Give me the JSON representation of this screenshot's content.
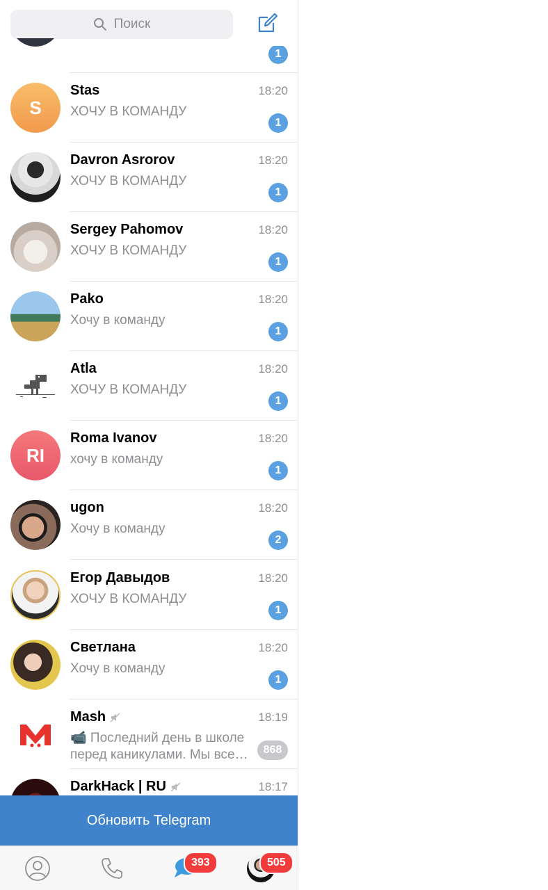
{
  "search": {
    "placeholder": "Поиск"
  },
  "colors": {
    "accent": "#3e83cb",
    "badge": "#5ba0e0",
    "muted_badge": "#c7c7cc",
    "tab_badge": "#f23c3c"
  },
  "chats": [
    {
      "name": "",
      "time": "",
      "message": "",
      "unread": "1",
      "avatar": "photo"
    },
    {
      "name": "Stas",
      "time": "18:20",
      "message": "ХОЧУ В КОМАНДУ",
      "unread": "1",
      "avatar": "initial",
      "initial": "S"
    },
    {
      "name": "Davron Asrorov",
      "time": "18:20",
      "message": "ХОЧУ В КОМАНДУ",
      "unread": "1",
      "avatar": "photo"
    },
    {
      "name": "Sergey Pahomov",
      "time": "18:20",
      "message": "ХОЧУ В КОМАНДУ",
      "unread": "1",
      "avatar": "photo"
    },
    {
      "name": "Pako",
      "time": "18:20",
      "message": "Хочу в команду",
      "unread": "1",
      "avatar": "photo"
    },
    {
      "name": "Atla",
      "time": "18:20",
      "message": "ХОЧУ В КОМАНДУ",
      "unread": "1",
      "avatar": "dino-icon"
    },
    {
      "name": "Roma Ivanov",
      "time": "18:20",
      "message": "хочу в команду",
      "unread": "1",
      "avatar": "initial",
      "initial": "RI"
    },
    {
      "name": "ugon",
      "time": "18:20",
      "message": "Хочу в команду",
      "unread": "2",
      "avatar": "photo"
    },
    {
      "name": "Егор Давыдов",
      "time": "18:20",
      "message": "ХОЧУ В КОМАНДУ",
      "unread": "1",
      "avatar": "photo"
    },
    {
      "name": "Светлана",
      "time": "18:20",
      "message": "Хочу в команду",
      "unread": "1",
      "avatar": "photo"
    },
    {
      "name": "Mash",
      "time": "18:19",
      "message": "📹 Последний день в школе перед каникулами. Мы все…",
      "unread": "868",
      "muted": true,
      "avatar": "mash-logo"
    },
    {
      "name": "DarkHack | RU",
      "time": "18:17",
      "message": "",
      "unread": "",
      "muted": true,
      "avatar": "photo"
    }
  ],
  "update_bar": {
    "label": "Обновить Telegram"
  },
  "tabs": [
    {
      "name": "contacts",
      "icon": "person-circle-icon",
      "badge": ""
    },
    {
      "name": "calls",
      "icon": "phone-icon",
      "badge": ""
    },
    {
      "name": "chats",
      "icon": "chat-bubbles-icon",
      "badge": "393"
    },
    {
      "name": "settings",
      "icon": "profile-avatar",
      "badge": "505"
    }
  ]
}
